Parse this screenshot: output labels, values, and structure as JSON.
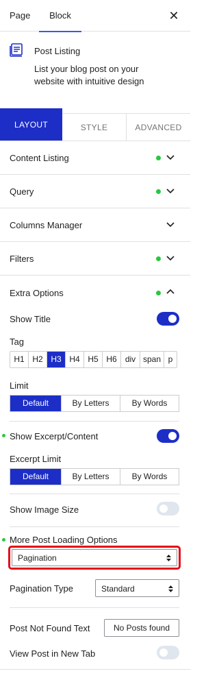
{
  "header": {
    "tabs": [
      {
        "label": "Page"
      },
      {
        "label": "Block"
      }
    ],
    "close_icon": "close-icon"
  },
  "block": {
    "title": "Post Listing",
    "description_lines": [
      "List your blog post on your",
      "website with intuitive design"
    ]
  },
  "mode_tabs": [
    {
      "label": "LAYOUT"
    },
    {
      "label": "STYLE"
    },
    {
      "label": "ADVANCED"
    }
  ],
  "sections": [
    {
      "label": "Content Listing",
      "has_dot": true
    },
    {
      "label": "Query",
      "has_dot": true
    },
    {
      "label": "Columns Manager",
      "has_dot": false
    },
    {
      "label": "Filters",
      "has_dot": true
    }
  ],
  "extra_options": {
    "label": "Extra Options",
    "show_title": {
      "label": "Show Title",
      "value": true
    },
    "tag": {
      "label": "Tag",
      "options": [
        "H1",
        "H2",
        "H3",
        "H4",
        "H5",
        "H6",
        "div",
        "span",
        "p"
      ],
      "selected": "H3"
    },
    "limit": {
      "label": "Limit",
      "options": [
        "Default",
        "By Letters",
        "By Words"
      ],
      "selected": "Default"
    },
    "show_excerpt": {
      "label": "Show Excerpt/Content",
      "value": true
    },
    "excerpt_limit": {
      "label": "Excerpt Limit",
      "options": [
        "Default",
        "By Letters",
        "By Words"
      ],
      "selected": "Default"
    },
    "show_image_size": {
      "label": "Show Image Size",
      "value": false
    },
    "more_post_loading": {
      "label": "More Post Loading Options",
      "value": "Pagination"
    },
    "pagination_type": {
      "label": "Pagination Type",
      "value": "Standard"
    },
    "post_not_found": {
      "label": "Post Not Found Text",
      "value": "No Posts found"
    },
    "view_post_new_tab": {
      "label": "View Post in New Tab",
      "value": false
    }
  },
  "colors": {
    "accent": "#1d2ec7",
    "dot": "#27c840",
    "highlight": "#e30b17",
    "tab_underline": "#3858e9"
  }
}
